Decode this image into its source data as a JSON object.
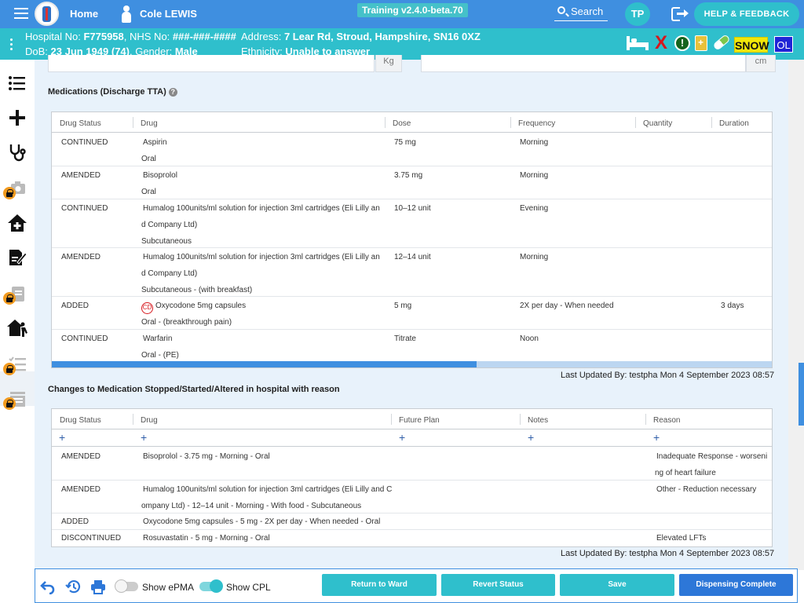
{
  "topbar": {
    "home_label": "Home",
    "patient_name": "Cole LEWIS",
    "version_label": "Training v2.4.0-beta.70",
    "search_label": "Search",
    "user_initials": "TP",
    "help_label": "HELP & FEEDBACK"
  },
  "patient": {
    "hospital_no_label": "Hospital No:",
    "hospital_no": "F775958",
    "nhs_no_label": "NHS No:",
    "nhs_no": "###-###-####",
    "address_label": "Address:",
    "address": "7 Lear Rd, Stroud, Hampshire, SN16 0XZ",
    "dob_label": "DoB:",
    "dob": "23 Jun 1949 (74)",
    "gender_label": "Gender:",
    "gender": "Male",
    "ethnicity_label": "Ethnicity:",
    "ethnicity": "Unable to answer",
    "alerts": {
      "snow_label": "SNOW",
      "ol_label": "OL",
      "x_label": "X",
      "excl_label": "!"
    }
  },
  "inputs": {
    "weight_unit": "Kg",
    "height_unit": "cm"
  },
  "medications": {
    "title": "Medications (Discharge TTA)",
    "help_glyph": "?",
    "columns": [
      "Drug Status",
      "Drug",
      "Dose",
      "Frequency",
      "Quantity",
      "Duration"
    ],
    "rows": [
      {
        "status": "CONTINUED",
        "drug": "Aspirin",
        "drug2": "",
        "route": "Oral",
        "dose": "75 mg",
        "frequency": "Morning",
        "quantity": "",
        "duration": ""
      },
      {
        "status": "AMENDED",
        "drug": "Bisoprolol",
        "drug2": "",
        "route": "Oral",
        "dose": "3.75 mg",
        "frequency": "Morning",
        "quantity": "",
        "duration": ""
      },
      {
        "status": "CONTINUED",
        "drug": "Humalog 100units/ml solution for injection 3ml cartridges (Eli Lilly an",
        "drug2": "d Company Ltd)",
        "route": "Subcutaneous",
        "dose": "10–12 unit",
        "frequency": "Evening",
        "quantity": "",
        "duration": ""
      },
      {
        "status": "AMENDED",
        "drug": "Humalog 100units/ml solution for injection 3ml cartridges (Eli Lilly an",
        "drug2": "d Company Ltd)",
        "route": "Subcutaneous - (with breakfast)",
        "dose": "12–14 unit",
        "frequency": "Morning",
        "quantity": "",
        "duration": ""
      },
      {
        "status": "ADDED",
        "cd_label": "CD",
        "drug": "Oxycodone 5mg capsules",
        "drug2": "",
        "route": "Oral - (breakthrough pain)",
        "dose": "5 mg",
        "frequency": "2X per day - When needed",
        "quantity": "",
        "duration": "3 days"
      },
      {
        "status": "CONTINUED",
        "drug": "Warfarin",
        "drug2": "",
        "route": "Oral - (PE)",
        "dose": "Titrate",
        "frequency": "Noon",
        "quantity": "",
        "duration": ""
      }
    ],
    "scroll_fraction": 0.59,
    "last_updated": "Last Updated By: testpha Mon 4 September 2023 08:57"
  },
  "changes": {
    "title": "Changes to Medication Stopped/Started/Altered in hospital with reason",
    "columns": [
      "Drug Status",
      "Drug",
      "Future Plan",
      "Notes",
      "Reason"
    ],
    "add_glyph": "+",
    "rows": [
      {
        "status": "AMENDED",
        "drug": "Bisoprolol - 3.75 mg - Morning - Oral",
        "drug2": "",
        "reason": "Inadequate Response - worseni",
        "reason2": "ng of heart failure"
      },
      {
        "status": "AMENDED",
        "drug": "Humalog 100units/ml solution for injection 3ml cartridges (Eli Lilly and C",
        "drug2": "ompany Ltd) - 12–14 unit - Morning - With food - Subcutaneous",
        "reason": "Other - Reduction necessary",
        "reason2": ""
      },
      {
        "status": "ADDED",
        "drug": "Oxycodone 5mg capsules - 5 mg - 2X per day - When needed - Oral",
        "drug2": "",
        "reason": "",
        "reason2": ""
      },
      {
        "status": "DISCONTINUED",
        "drug": "Rosuvastatin - 5 mg - Morning - Oral",
        "drug2": "",
        "reason": "Elevated LFTs",
        "reason2": ""
      }
    ],
    "last_updated": "Last Updated By: testpha Mon 4 September 2023 08:57"
  },
  "footer": {
    "show_epma_label": "Show ePMA",
    "show_epma_on": false,
    "show_cpl_label": "Show CPL",
    "show_cpl_on": true,
    "buttons": {
      "return_to_ward": "Return to Ward",
      "revert_status": "Revert Status",
      "save": "Save",
      "dispensing_complete": "Dispensing Complete"
    }
  },
  "colors": {
    "topbar": "#3f8fe0",
    "patientbar": "#2fbfcc",
    "primary_button": "#2d77d8",
    "snow": "#f2e70a",
    "lock": "#f29a1e"
  }
}
